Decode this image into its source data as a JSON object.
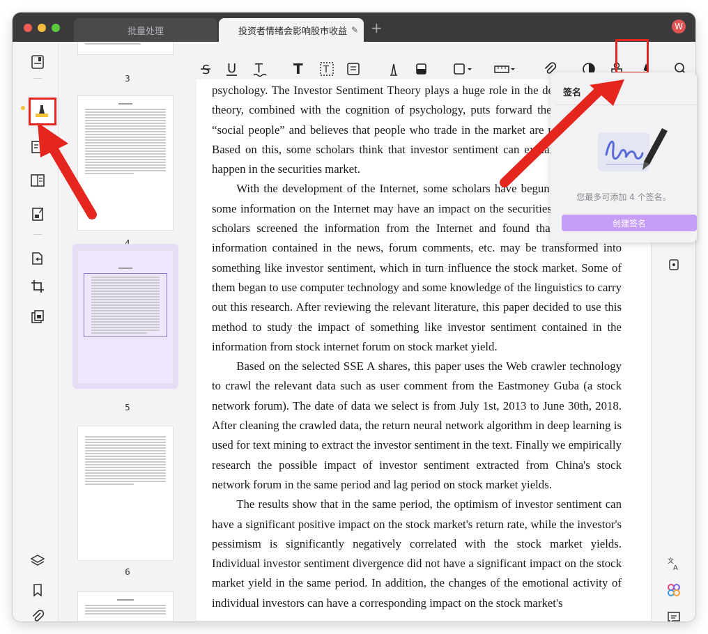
{
  "window": {
    "tabs": [
      {
        "label": "批量处理"
      },
      {
        "label": "投资者情绪会影响股市收益"
      }
    ],
    "avatar_letter": "W"
  },
  "thumbnails": [
    {
      "label": "3"
    },
    {
      "label": "4"
    },
    {
      "label": "5"
    },
    {
      "label": "6"
    }
  ],
  "popover": {
    "title": "签名",
    "note": "您最多可添加 4 个签名。",
    "create_button": "创建签名"
  },
  "document": {
    "paragraphs": [
      "psychology. The Investor Sentiment Theory plays a huge role in the developing. This theory, combined with the cognition of psychology, puts forward the hypothesis of “social people” and believes that people who trade in the market are not all rational. Based on this, some scholars think that investor sentiment can explain some which happen in the securities market.",
      "With the development of the Internet, some scholars have begun to think about some information on the Internet may have an impact on the securities market. Some scholars screened the information from the Internet and found that some of the information contained in the news, forum comments, etc. may be transformed into something like investor sentiment, which in turn influence the stock market. Some of them began to use computer technology and some knowledge of the linguistics to carry out this research. After reviewing the relevant literature, this paper decided to use this method to study the impact of something like investor sentiment contained in the information from stock internet forum on stock market yield.",
      "Based on the selected SSE A shares, this paper uses the Web crawler technology to crawl the relevant data such as user comment from the Eastmoney Guba (a stock network forum). The date of data we select is from July 1st, 2013 to June 30th, 2018. After cleaning the crawled data, the return neural network algorithm in deep learning is used for text mining to extract the investor sentiment in the text. Finally we empirically research the possible impact of  investor sentiment extracted from China's stock network forum in the same period and lag period on stock market yields.",
      "The results show that in the same period, the optimism of investor sentiment can have a significant positive impact on the stock market's return rate, while the investor's pessimism is significantly negatively correlated with the stock market yields. Individual investor sentiment divergence did not have a significant impact on the stock market yield in the same period. In addition, the changes of the emotional activity of individual investors can have a corresponding impact on the stock market's"
    ]
  }
}
